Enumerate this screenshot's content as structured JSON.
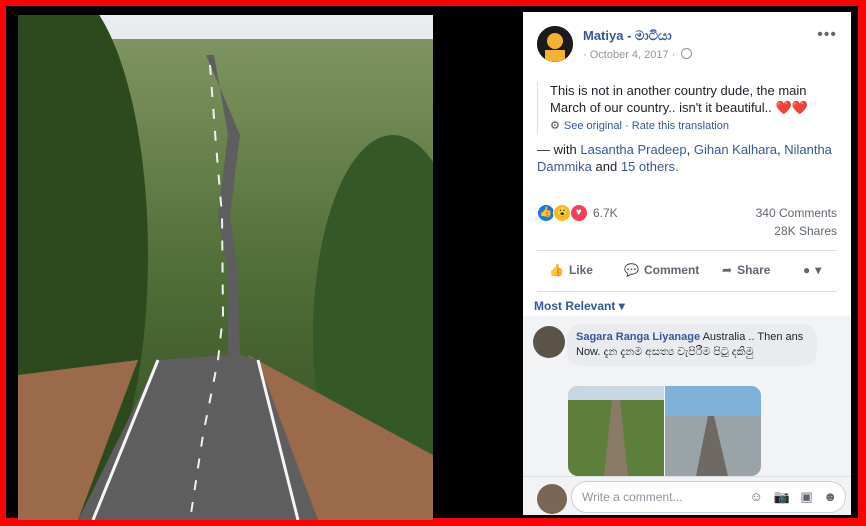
{
  "post": {
    "author": "Matiya - මාටියා",
    "date": "October 4, 2017",
    "text": "This is not in another country dude, the main March of our country.. isn't it beautiful..",
    "hearts": "❤️❤️",
    "see_original": "See original",
    "rate_translation": "Rate this translation",
    "with_prefix": "— with",
    "tag1": "Lasantha Pradeep",
    "tag2": "Gihan Kalhara",
    "tag3": "Nilantha Dammika",
    "and": "and",
    "others": "15 others."
  },
  "reactions": {
    "count": "6.7K",
    "comments": "340 Comments",
    "shares": "28K Shares"
  },
  "actions": {
    "like": "Like",
    "comment": "Comment",
    "share": "Share"
  },
  "sort_label": "Most Relevant",
  "comment1": {
    "author": "Sagara Ranga Liyanage",
    "text": "Australia .. Then ans Now. දැන දැනම අසත්‍ය වැපිරීම පිටු දකිමු"
  },
  "write_comment": {
    "placeholder": "Write a comment..."
  },
  "colors": {
    "frame": "#ff0000",
    "link": "#365899",
    "like_blue": "#1877f2"
  }
}
